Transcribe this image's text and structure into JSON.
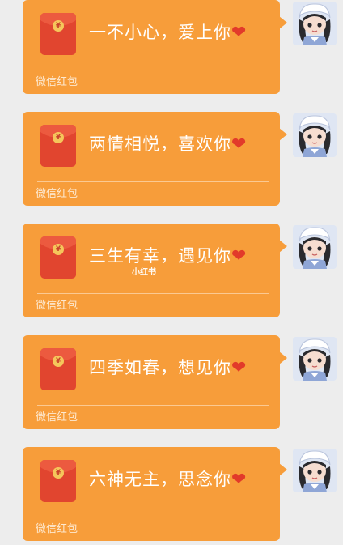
{
  "accent_color": "#f79d3a",
  "envelope_color": "#e1452f",
  "seal_symbol": "¥",
  "footer_label": "微信红包",
  "watermark": "小红书",
  "messages": [
    {
      "text": "一不小心，爱上你",
      "heart": "❤"
    },
    {
      "text": "两情相悦，喜欢你",
      "heart": "❤"
    },
    {
      "text": "三生有幸，遇见你",
      "heart": "❤"
    },
    {
      "text": "四季如春，想见你",
      "heart": "❤"
    },
    {
      "text": "六神无主，思念你",
      "heart": "❤"
    }
  ]
}
